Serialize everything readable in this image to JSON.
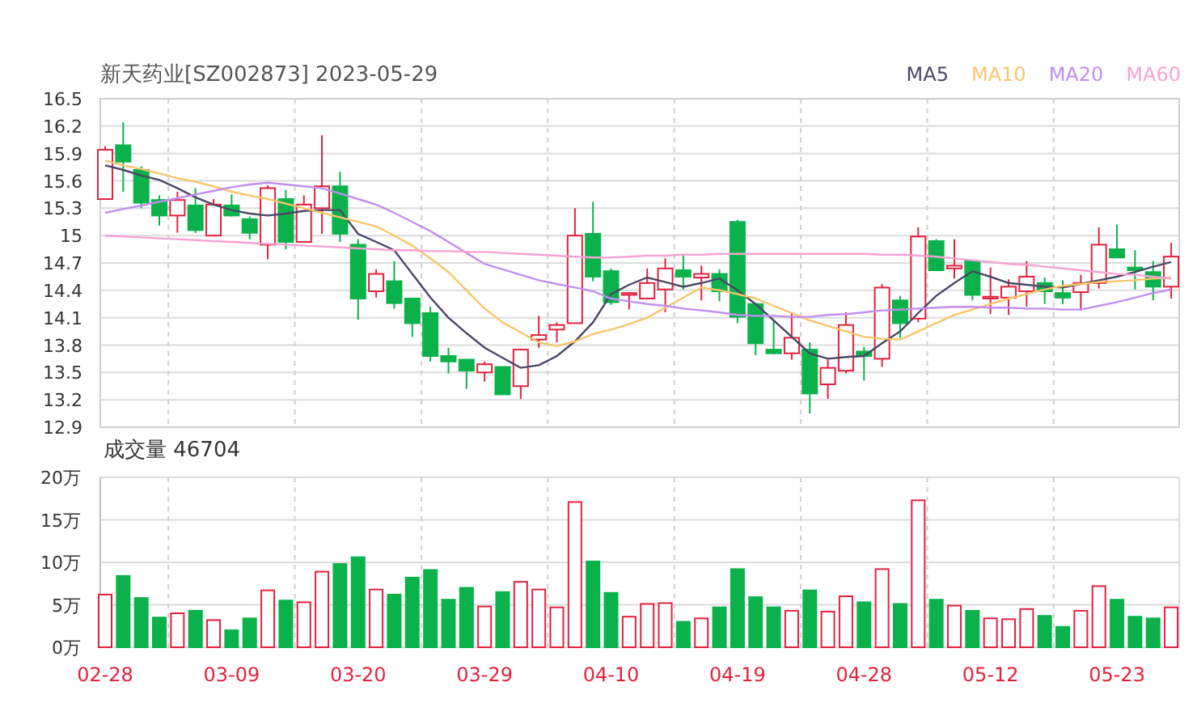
{
  "price_chart": {
    "chart_data": {
      "type": "candlestick",
      "title": "新天药业[SZ002873] 2023-05-29",
      "grid": true,
      "ylim": [
        12.9,
        16.5
      ],
      "yticks": [
        12.9,
        13.2,
        13.5,
        13.8,
        14.1,
        14.4,
        14.7,
        15,
        15.3,
        15.6,
        15.9,
        16.2,
        16.5
      ],
      "ohlc": [
        [
          15.4,
          15.98,
          15.4,
          15.94
        ],
        [
          15.99,
          16.24,
          15.48,
          15.81
        ],
        [
          15.72,
          15.76,
          15.3,
          15.36
        ],
        [
          15.39,
          15.44,
          15.11,
          15.22
        ],
        [
          15.22,
          15.48,
          15.03,
          15.39
        ],
        [
          15.33,
          15.52,
          15.03,
          15.06
        ],
        [
          15.0,
          15.4,
          15.0,
          15.34
        ],
        [
          15.33,
          15.45,
          15.21,
          15.22
        ],
        [
          15.18,
          15.21,
          14.96,
          15.03
        ],
        [
          14.9,
          15.55,
          14.74,
          15.52
        ],
        [
          15.4,
          15.5,
          14.85,
          14.93
        ],
        [
          14.93,
          15.44,
          14.93,
          15.34
        ],
        [
          15.3,
          16.1,
          15.02,
          15.54
        ],
        [
          15.54,
          15.7,
          14.93,
          15.02
        ],
        [
          14.9,
          14.96,
          14.08,
          14.31
        ],
        [
          14.39,
          14.63,
          14.32,
          14.58
        ],
        [
          14.5,
          14.72,
          14.2,
          14.26
        ],
        [
          14.31,
          14.31,
          13.89,
          14.04
        ],
        [
          14.15,
          14.22,
          13.62,
          13.68
        ],
        [
          13.68,
          13.77,
          13.49,
          13.62
        ],
        [
          13.64,
          13.64,
          13.32,
          13.52
        ],
        [
          13.5,
          13.62,
          13.4,
          13.59
        ],
        [
          13.56,
          13.56,
          13.26,
          13.26
        ],
        [
          13.35,
          13.75,
          13.21,
          13.75
        ],
        [
          13.86,
          14.12,
          13.77,
          13.91
        ],
        [
          13.97,
          14.05,
          13.83,
          14.02
        ],
        [
          14.04,
          15.3,
          14.04,
          15.0
        ],
        [
          15.02,
          15.37,
          14.5,
          14.55
        ],
        [
          14.61,
          14.64,
          14.24,
          14.27
        ],
        [
          14.35,
          14.38,
          14.19,
          14.37
        ],
        [
          14.31,
          14.64,
          14.3,
          14.48
        ],
        [
          14.41,
          14.75,
          14.16,
          14.64
        ],
        [
          14.62,
          14.78,
          14.41,
          14.55
        ],
        [
          14.54,
          14.67,
          14.29,
          14.58
        ],
        [
          14.58,
          14.63,
          14.28,
          14.39
        ],
        [
          15.15,
          15.17,
          14.04,
          14.11
        ],
        [
          14.25,
          14.25,
          13.69,
          13.82
        ],
        [
          13.75,
          14.07,
          13.7,
          13.71
        ],
        [
          13.71,
          14.16,
          13.64,
          13.88
        ],
        [
          13.75,
          13.83,
          13.05,
          13.27
        ],
        [
          13.37,
          13.64,
          13.21,
          13.55
        ],
        [
          13.52,
          14.16,
          13.49,
          14.02
        ],
        [
          13.73,
          13.78,
          13.41,
          13.68
        ],
        [
          13.65,
          14.47,
          13.56,
          14.43
        ],
        [
          14.29,
          14.34,
          13.88,
          14.04
        ],
        [
          14.09,
          15.09,
          14.05,
          14.99
        ],
        [
          14.94,
          14.96,
          14.62,
          14.62
        ],
        [
          14.64,
          14.96,
          14.53,
          14.67
        ],
        [
          14.72,
          14.73,
          14.29,
          14.35
        ],
        [
          14.31,
          14.65,
          14.14,
          14.33
        ],
        [
          14.32,
          14.52,
          14.13,
          14.44
        ],
        [
          14.39,
          14.72,
          14.22,
          14.55
        ],
        [
          14.48,
          14.54,
          14.25,
          14.39
        ],
        [
          14.37,
          14.51,
          14.25,
          14.32
        ],
        [
          14.38,
          14.57,
          14.18,
          14.48
        ],
        [
          14.48,
          15.09,
          14.42,
          14.9
        ],
        [
          14.85,
          15.12,
          14.75,
          14.76
        ],
        [
          14.65,
          14.84,
          14.41,
          14.62
        ],
        [
          14.6,
          14.72,
          14.29,
          14.44
        ],
        [
          14.44,
          14.92,
          14.31,
          14.77
        ]
      ],
      "series": [
        {
          "name": "MA5",
          "type": "line",
          "color": "#4b4766",
          "values": [
            15.77,
            15.72,
            15.66,
            15.61,
            15.52,
            15.42,
            15.34,
            15.28,
            15.24,
            15.22,
            15.24,
            15.27,
            15.28,
            15.28,
            15.02,
            14.93,
            14.84,
            14.58,
            14.32,
            14.1,
            13.93,
            13.77,
            13.66,
            13.55,
            13.58,
            13.68,
            13.84,
            14.05,
            14.36,
            14.46,
            14.54,
            14.49,
            14.44,
            14.48,
            14.53,
            14.4,
            14.25,
            14.07,
            13.89,
            13.71,
            13.65,
            13.67,
            13.68,
            13.82,
            13.95,
            14.15,
            14.34,
            14.48,
            14.61,
            14.55,
            14.48,
            14.46,
            14.44,
            14.43,
            14.47,
            14.51,
            14.55,
            14.6,
            14.66,
            14.71
          ]
        },
        {
          "name": "MA10",
          "type": "line",
          "color": "#f9c56a",
          "values": [
            15.82,
            15.77,
            15.73,
            15.68,
            15.63,
            15.59,
            15.54,
            15.48,
            15.44,
            15.4,
            15.35,
            15.3,
            15.25,
            15.2,
            15.15,
            15.1,
            15.0,
            14.89,
            14.75,
            14.6,
            14.4,
            14.2,
            14.05,
            13.94,
            13.83,
            13.79,
            13.84,
            13.92,
            13.97,
            14.03,
            14.1,
            14.21,
            14.32,
            14.43,
            14.4,
            14.36,
            14.31,
            14.23,
            14.15,
            14.07,
            14.01,
            13.95,
            13.89,
            13.87,
            13.86,
            13.95,
            14.04,
            14.13,
            14.19,
            14.25,
            14.31,
            14.36,
            14.41,
            14.45,
            14.47,
            14.49,
            14.5,
            14.51,
            14.53,
            14.54
          ]
        },
        {
          "name": "MA20",
          "type": "line",
          "color": "#c28ef0",
          "values": [
            15.25,
            15.29,
            15.33,
            15.37,
            15.41,
            15.45,
            15.49,
            15.53,
            15.56,
            15.58,
            15.56,
            15.54,
            15.52,
            15.46,
            15.4,
            15.34,
            15.25,
            15.15,
            15.05,
            14.93,
            14.81,
            14.69,
            14.63,
            14.57,
            14.51,
            14.47,
            14.43,
            14.39,
            14.31,
            14.28,
            14.25,
            14.23,
            14.2,
            14.18,
            14.16,
            14.13,
            14.12,
            14.12,
            14.11,
            14.11,
            14.13,
            14.14,
            14.16,
            14.18,
            14.19,
            14.2,
            14.21,
            14.22,
            14.22,
            14.21,
            14.21,
            14.2,
            14.2,
            14.19,
            14.19,
            14.23,
            14.27,
            14.32,
            14.37,
            14.41
          ]
        },
        {
          "name": "MA60",
          "type": "line",
          "color": "#f7a3d3",
          "values": [
            15.0,
            14.99,
            14.98,
            14.97,
            14.96,
            14.95,
            14.94,
            14.93,
            14.92,
            14.91,
            14.9,
            14.89,
            14.88,
            14.87,
            14.86,
            14.85,
            14.84,
            14.84,
            14.83,
            14.83,
            14.82,
            14.82,
            14.81,
            14.8,
            14.79,
            14.78,
            14.77,
            14.76,
            14.76,
            14.77,
            14.78,
            14.78,
            14.79,
            14.79,
            14.8,
            14.8,
            14.8,
            14.8,
            14.8,
            14.8,
            14.8,
            14.8,
            14.8,
            14.79,
            14.79,
            14.78,
            14.77,
            14.75,
            14.73,
            14.71,
            14.69,
            14.68,
            14.66,
            14.64,
            14.62,
            14.6,
            14.58,
            14.57,
            14.55,
            14.53
          ]
        }
      ]
    }
  },
  "volume_chart": {
    "chart_data": {
      "type": "bar",
      "title": "成交量 46704",
      "grid": true,
      "ylim": [
        0,
        20
      ],
      "yticks": [
        {
          "value": 0,
          "label": "0万"
        },
        {
          "value": 5,
          "label": "5万"
        },
        {
          "value": 10,
          "label": "10万"
        },
        {
          "value": 15,
          "label": "15万"
        },
        {
          "value": 20,
          "label": "20万"
        }
      ],
      "categories": [
        "02-28",
        null,
        null,
        null,
        null,
        null,
        null,
        "03-09",
        null,
        null,
        null,
        null,
        null,
        null,
        "03-20",
        null,
        null,
        null,
        null,
        null,
        null,
        "03-29",
        null,
        null,
        null,
        null,
        null,
        null,
        "04-10",
        null,
        null,
        null,
        null,
        null,
        null,
        "04-19",
        null,
        null,
        null,
        null,
        null,
        null,
        "04-28",
        null,
        null,
        null,
        null,
        null,
        null,
        "05-12",
        null,
        null,
        null,
        null,
        null,
        null,
        "05-23",
        null,
        null,
        null
      ],
      "values": [
        6.2,
        8.4,
        5.8,
        3.5,
        4.0,
        4.3,
        3.2,
        2.0,
        3.4,
        6.7,
        5.5,
        5.3,
        8.9,
        9.8,
        10.6,
        6.8,
        6.2,
        8.2,
        9.1,
        5.6,
        7.0,
        4.8,
        6.5,
        7.7,
        6.8,
        4.7,
        17.1,
        10.1,
        6.4,
        3.6,
        5.1,
        5.2,
        3.0,
        3.4,
        4.7,
        9.2,
        5.9,
        4.7,
        4.3,
        6.7,
        4.2,
        6.0,
        5.3,
        9.2,
        5.1,
        17.3,
        5.6,
        4.9,
        4.3,
        3.4,
        3.3,
        4.5,
        3.7,
        2.4,
        4.3,
        7.2,
        5.6,
        3.6,
        3.4,
        4.7
      ]
    }
  }
}
